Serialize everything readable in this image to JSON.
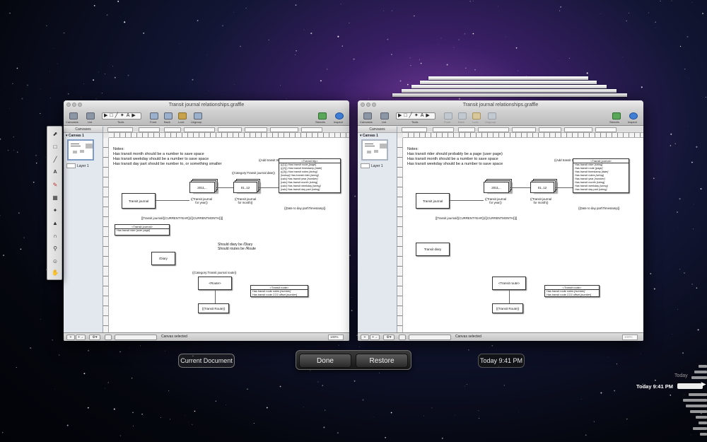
{
  "window_title": "Transit journal relationships.graffle",
  "toolbar": {
    "canvases": "Canvases",
    "list": "List",
    "tools": "Tools",
    "front": "Front",
    "back": "Back",
    "lock": "Lock",
    "ungroup": "Ungroup",
    "stencils": "Stencils",
    "inspect": "Inspect"
  },
  "sidebar": {
    "header": "Canvases",
    "canvas_name": "Canvas 1",
    "layer_name": "Layer 1"
  },
  "status": {
    "text": "Canvas selected",
    "zoom": "100%",
    "add": "+",
    "add_layer": "+→",
    "action": "⚙▾"
  },
  "left_doc": {
    "notes": [
      "Notes:",
      "Has transit month should be a number to save space",
      "Has transit weekday should be a number to save space",
      "Has transit day part should be number to, or something smaller"
    ],
    "add_trip_label": "((Add transit trip\\Person\\Route\\Timestamp\\here))",
    "category_label": "((Category:Transit journal date))",
    "transit_journal": "Transit journal",
    "year_stack": "2011,..",
    "month_stack": "01..12",
    "year_caption": [
      "((Transit journal",
      "for year))"
    ],
    "month_caption": [
      "((Transit journal",
      "for month))"
    ],
    "link_caption": "[[Transit journal/{{CURRENTYEAR}}/{{CURRENTMONTH}}]]",
    "date_caption": "{{Date to day part\\Timestamp}}",
    "trip_entity": {
      "header": "<Transit trip>",
      "rows": [
        {
          "label": "(((1))) Has transit route ",
          "type": "[page]"
        },
        {
          "label": "(((2))) Has transit timestamp ",
          "type": "[date]"
        },
        {
          "label": "(((3))) Has transit notes ",
          "type": "[string]"
        },
        {
          "label": "[lookup] Has transit rider ",
          "type": "[string]"
        },
        {
          "label": "[calc] Has transit year ",
          "type": "[number]"
        },
        {
          "label": "[calc] Has transit month ",
          "type": "[string]"
        },
        {
          "label": "[calc] Has transit weekday ",
          "type": "[string]"
        },
        {
          "label": "[calc] Has transit day part ",
          "type": "[string]"
        }
      ]
    },
    "journal_entity": {
      "header": "<Transit journal>",
      "rows": [
        {
          "label": "Has transit rider ",
          "type": "[user page]"
        }
      ]
    },
    "diary": "/Diary",
    "should_1": "Should diary be /Diary",
    "should_2": "Should routes be /Route",
    "route_category": "((Category:Transit journal route))",
    "route": "<Route>",
    "route_entity": {
      "header": "<Transit route>",
      "rows": [
        {
          "label": "Has transit route notes ",
          "type": "[number]"
        },
        {
          "label": "Has transit route CO2 offset ",
          "type": "[number]"
        }
      ]
    },
    "transit_route": "((Transit Route))"
  },
  "right_doc": {
    "notes": [
      "Notes:",
      "Has transit rider should probably be a page (user page)",
      "Has transit month should be a number to save space",
      "Has transit weekday should be a number to save space"
    ],
    "add_trip_label": "((Add transit trip\\Person\\Route\\Timestamp\\here))",
    "transit_journal": "Transit journal",
    "year_stack": "2011,..",
    "month_stack": "01..12",
    "year_caption": [
      "((Transit journal",
      "for year))"
    ],
    "month_caption": [
      "((Transit journal",
      "for month))"
    ],
    "link_caption": "[[Transit journal/{{CURRENTYEAR}}/{{CURRENTMONTH}}]]",
    "date_caption": "{{Date to day part\\Timestamp}}",
    "journal_entity": {
      "header": "<Transit journal>",
      "rows": [
        {
          "label": "Has transit rider ",
          "type": "[string]"
        },
        {
          "label": "Has transit route ",
          "type": "[page]"
        },
        {
          "label": "Has transit timestamp ",
          "type": "[date]"
        },
        {
          "label": "Has transit notes ",
          "type": "[string]"
        },
        {
          "label": "Has transit year ",
          "type": "[number]"
        },
        {
          "label": "Has transit month ",
          "type": "[string]"
        },
        {
          "label": "Has transit weekday ",
          "type": "[string]"
        },
        {
          "label": "Has transit day part ",
          "type": "[string]"
        }
      ]
    },
    "diary": "Transit diary",
    "route": "<Transit route>",
    "route_entity": {
      "header": "<Transit route>",
      "rows": [
        {
          "label": "Has transit route notes ",
          "type": "[number]"
        },
        {
          "label": "Has transit route CO2 offset ",
          "type": "[number]"
        }
      ]
    },
    "transit_route": "((Transit Route))"
  },
  "time_machine": {
    "current_document": "Current Document",
    "done": "Done",
    "restore": "Restore",
    "backup_time": "Today 9:41 PM",
    "timeline_today": "Today",
    "timeline_selected": "Today 9:41 PM"
  }
}
